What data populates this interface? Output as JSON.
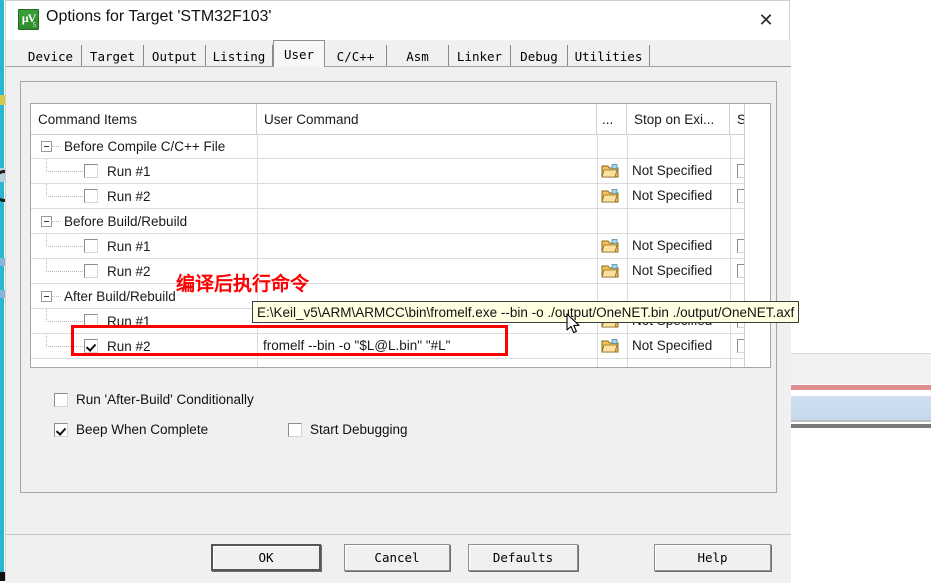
{
  "window": {
    "title": "Options for Target 'STM32F103'",
    "app_icon": "keil-uvision-icon",
    "close_icon": "✕"
  },
  "tabs": [
    {
      "label": "Device",
      "active": false
    },
    {
      "label": "Target",
      "active": false
    },
    {
      "label": "Output",
      "active": false
    },
    {
      "label": "Listing",
      "active": false
    },
    {
      "label": "User",
      "active": true
    },
    {
      "label": "C/C++",
      "active": false
    },
    {
      "label": "Asm",
      "active": false
    },
    {
      "label": "Linker",
      "active": false
    },
    {
      "label": "Debug",
      "active": false
    },
    {
      "label": "Utilities",
      "active": false
    }
  ],
  "grid": {
    "headers": {
      "command_items": "Command Items",
      "user_command": "User Command",
      "browse": "...",
      "stop_on_exit": "Stop on Exi...",
      "s_column": "S..."
    },
    "rows": [
      {
        "type": "group",
        "label": "Before Compile C/C++ File",
        "command": "",
        "stop": "",
        "has_controls": false
      },
      {
        "type": "item",
        "label": "Run #1",
        "checked": false,
        "command": "",
        "stop": "Not Specified",
        "has_controls": true
      },
      {
        "type": "item",
        "label": "Run #2",
        "checked": false,
        "command": "",
        "stop": "Not Specified",
        "has_controls": true
      },
      {
        "type": "group",
        "label": "Before Build/Rebuild",
        "command": "",
        "stop": "",
        "has_controls": false
      },
      {
        "type": "item",
        "label": "Run #1",
        "checked": false,
        "command": "",
        "stop": "Not Specified",
        "has_controls": true
      },
      {
        "type": "item",
        "label": "Run #2",
        "checked": false,
        "command": "",
        "stop": "Not Specified",
        "has_controls": true
      },
      {
        "type": "group",
        "label": "After Build/Rebuild",
        "command": "",
        "stop": "",
        "has_controls": false
      },
      {
        "type": "item",
        "label": "Run #1",
        "checked": false,
        "command": "",
        "stop": "Not Specified",
        "has_controls": true
      },
      {
        "type": "item",
        "label": "Run #2",
        "checked": true,
        "command": "fromelf --bin -o \"$L@L.bin\" \"#L\"",
        "stop": "Not Specified",
        "has_controls": true
      }
    ]
  },
  "tooltip": {
    "text": "E:\\Keil_v5\\ARM\\ARMCC\\bin\\fromelf.exe --bin -o ./output/OneNET.bin  ./output/OneNET.axf"
  },
  "annotation": {
    "chinese_note": "编译后执行命令",
    "highlight_color": "#ff0000"
  },
  "options": [
    {
      "label": "Run 'After-Build' Conditionally",
      "checked": false
    },
    {
      "label": "Beep When Complete",
      "checked": true
    },
    {
      "label": "Start Debugging",
      "checked": false
    }
  ],
  "buttons": [
    {
      "label": "OK",
      "default": true
    },
    {
      "label": "Cancel",
      "default": false
    },
    {
      "label": "Defaults",
      "default": false
    },
    {
      "label": "Help",
      "default": false
    }
  ],
  "colors": {
    "dialog_bg": "#f0f0f0",
    "grid_bg": "#ffffff",
    "tooltip_bg": "#ffffe1",
    "accent_cyan": "#29b6d0",
    "annotation_red": "#ff0000"
  }
}
